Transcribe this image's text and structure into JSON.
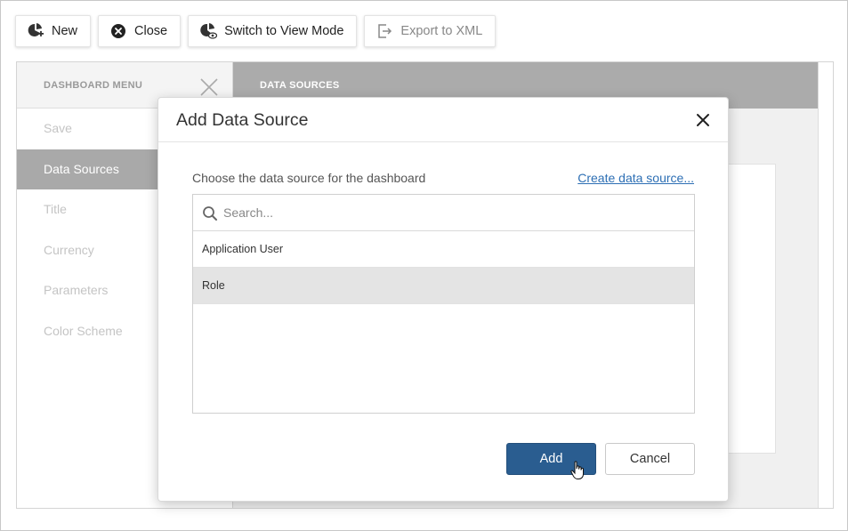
{
  "toolbar": {
    "items": [
      {
        "label": "New",
        "icon": "new-dashboard-icon"
      },
      {
        "label": "Close",
        "icon": "close-circle-icon"
      },
      {
        "label": "Switch to View Mode",
        "icon": "view-mode-icon"
      },
      {
        "label": "Export to XML",
        "icon": "export-icon",
        "disabled": true
      }
    ]
  },
  "dashboard_menu": {
    "title": "DASHBOARD MENU",
    "items": [
      {
        "label": "Save"
      },
      {
        "label": "Data Sources",
        "active": true
      },
      {
        "label": "Title"
      },
      {
        "label": "Currency"
      },
      {
        "label": "Parameters"
      },
      {
        "label": "Color Scheme"
      }
    ]
  },
  "data_sources_panel": {
    "title": "DATA SOURCES"
  },
  "modal": {
    "title": "Add Data Source",
    "prompt": "Choose the data source for the dashboard",
    "create_link": "Create data source...",
    "search_placeholder": "Search...",
    "items": [
      {
        "label": "Application User",
        "selected": false
      },
      {
        "label": "Role",
        "selected": true
      }
    ],
    "add_label": "Add",
    "cancel_label": "Cancel"
  },
  "colors": {
    "primary": "#2a5d90",
    "link": "#2d6fb4",
    "menu_active": "#a9a9a9",
    "panel_header": "#ababab"
  }
}
